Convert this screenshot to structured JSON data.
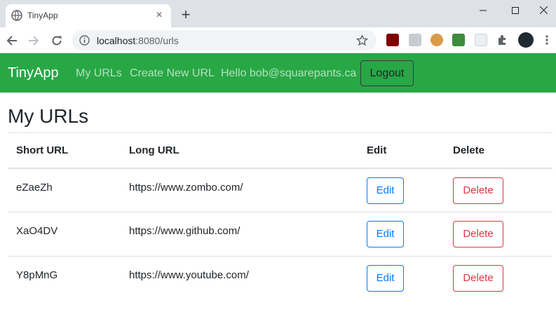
{
  "browser": {
    "tab_title": "TinyApp",
    "url_host": "localhost",
    "url_path": ":8080/urls"
  },
  "navbar": {
    "brand": "TinyApp",
    "links": [
      "My URLs",
      "Create New URL"
    ],
    "greeting": "Hello bob@squarepants.ca",
    "logout_label": "Logout",
    "bg_color": "#28a745"
  },
  "main": {
    "title": "My URLs",
    "columns": [
      "Short URL",
      "Long URL",
      "Edit",
      "Delete"
    ],
    "rows": [
      {
        "short": "eZaeZh",
        "long": "https://www.zombo.com/",
        "edit": "Edit",
        "delete": "Delete"
      },
      {
        "short": "XaO4DV",
        "long": "https://www.github.com/",
        "edit": "Edit",
        "delete": "Delete"
      },
      {
        "short": "Y8pMnG",
        "long": "https://www.youtube.com/",
        "edit": "Edit",
        "delete": "Delete"
      }
    ]
  }
}
